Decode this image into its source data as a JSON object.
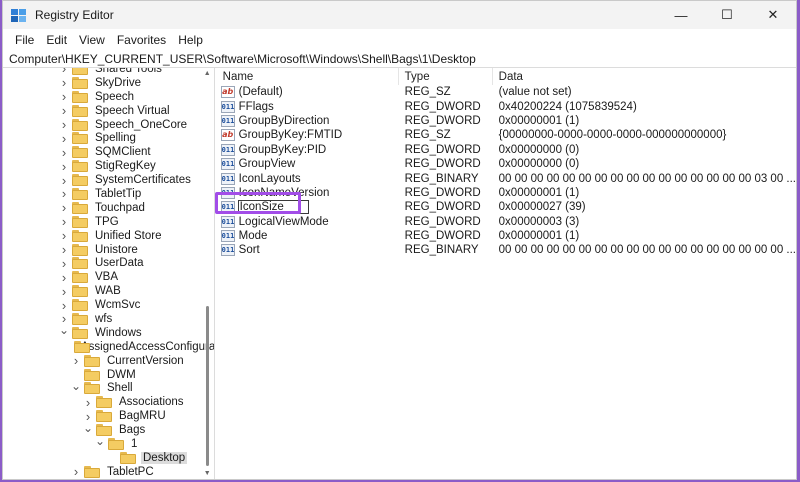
{
  "window": {
    "title": "Registry Editor",
    "controls": {
      "minimize": "—",
      "maximize": "☐",
      "close": "✕"
    },
    "accent": "#a24de8"
  },
  "menu": [
    "File",
    "Edit",
    "View",
    "Favorites",
    "Help"
  ],
  "address": "Computer\\HKEY_CURRENT_USER\\Software\\Microsoft\\Windows\\Shell\\Bags\\1\\Desktop",
  "tree": [
    {
      "label": "Shared Tools",
      "level": 0,
      "chevron": "right"
    },
    {
      "label": "SkyDrive",
      "level": 0,
      "chevron": "right"
    },
    {
      "label": "Speech",
      "level": 0,
      "chevron": "right"
    },
    {
      "label": "Speech Virtual",
      "level": 0,
      "chevron": "right"
    },
    {
      "label": "Speech_OneCore",
      "level": 0,
      "chevron": "right"
    },
    {
      "label": "Spelling",
      "level": 0,
      "chevron": "right"
    },
    {
      "label": "SQMClient",
      "level": 0,
      "chevron": "right"
    },
    {
      "label": "StigRegKey",
      "level": 0,
      "chevron": "right"
    },
    {
      "label": "SystemCertificates",
      "level": 0,
      "chevron": "right"
    },
    {
      "label": "TabletTip",
      "level": 0,
      "chevron": "right"
    },
    {
      "label": "Touchpad",
      "level": 0,
      "chevron": "right"
    },
    {
      "label": "TPG",
      "level": 0,
      "chevron": "right"
    },
    {
      "label": "Unified Store",
      "level": 0,
      "chevron": "right"
    },
    {
      "label": "Unistore",
      "level": 0,
      "chevron": "right"
    },
    {
      "label": "UserData",
      "level": 0,
      "chevron": "right"
    },
    {
      "label": "VBA",
      "level": 0,
      "chevron": "right"
    },
    {
      "label": "WAB",
      "level": 0,
      "chevron": "right"
    },
    {
      "label": "WcmSvc",
      "level": 0,
      "chevron": "right"
    },
    {
      "label": "wfs",
      "level": 0,
      "chevron": "right"
    },
    {
      "label": "Windows",
      "level": 0,
      "chevron": "down"
    },
    {
      "label": "AssignedAccessConfiguration",
      "level": 1,
      "chevron": "none"
    },
    {
      "label": "CurrentVersion",
      "level": 1,
      "chevron": "right"
    },
    {
      "label": "DWM",
      "level": 1,
      "chevron": "none"
    },
    {
      "label": "Shell",
      "level": 1,
      "chevron": "down"
    },
    {
      "label": "Associations",
      "level": 2,
      "chevron": "right"
    },
    {
      "label": "BagMRU",
      "level": 2,
      "chevron": "right"
    },
    {
      "label": "Bags",
      "level": 2,
      "chevron": "down"
    },
    {
      "label": "1",
      "level": 3,
      "chevron": "down"
    },
    {
      "label": "Desktop",
      "level": 4,
      "chevron": "none",
      "selected": true
    },
    {
      "label": "TabletPC",
      "level": 1,
      "chevron": "right"
    }
  ],
  "columns": {
    "name": "Name",
    "type": "Type",
    "data": "Data"
  },
  "values": [
    {
      "name": "(Default)",
      "type": "REG_SZ",
      "data": "(value not set)",
      "icon": "ab"
    },
    {
      "name": "FFlags",
      "type": "REG_DWORD",
      "data": "0x40200224 (1075839524)",
      "icon": "bin"
    },
    {
      "name": "GroupByDirection",
      "type": "REG_DWORD",
      "data": "0x00000001 (1)",
      "icon": "bin"
    },
    {
      "name": "GroupByKey:FMTID",
      "type": "REG_SZ",
      "data": "{00000000-0000-0000-0000-000000000000}",
      "icon": "ab"
    },
    {
      "name": "GroupByKey:PID",
      "type": "REG_DWORD",
      "data": "0x00000000 (0)",
      "icon": "bin"
    },
    {
      "name": "GroupView",
      "type": "REG_DWORD",
      "data": "0x00000000 (0)",
      "icon": "bin"
    },
    {
      "name": "IconLayouts",
      "type": "REG_BINARY",
      "data": "00 00 00 00 00 00 00 00 00 00 00 00 00 00 00 00 03 00 ...",
      "icon": "bin"
    },
    {
      "name": "IconNameVersion",
      "type": "REG_DWORD",
      "data": "0x00000001 (1)",
      "icon": "bin"
    },
    {
      "name": "IconSize",
      "type": "REG_DWORD",
      "data": "0x00000027 (39)",
      "icon": "bin",
      "editing": true
    },
    {
      "name": "LogicalViewMode",
      "type": "REG_DWORD",
      "data": "0x00000003 (3)",
      "icon": "bin"
    },
    {
      "name": "Mode",
      "type": "REG_DWORD",
      "data": "0x00000001 (1)",
      "icon": "bin"
    },
    {
      "name": "Sort",
      "type": "REG_BINARY",
      "data": "00 00 00 00 00 00 00 00 00 00 00 00 00 00 00 00 00 00 ...",
      "icon": "bin"
    }
  ]
}
